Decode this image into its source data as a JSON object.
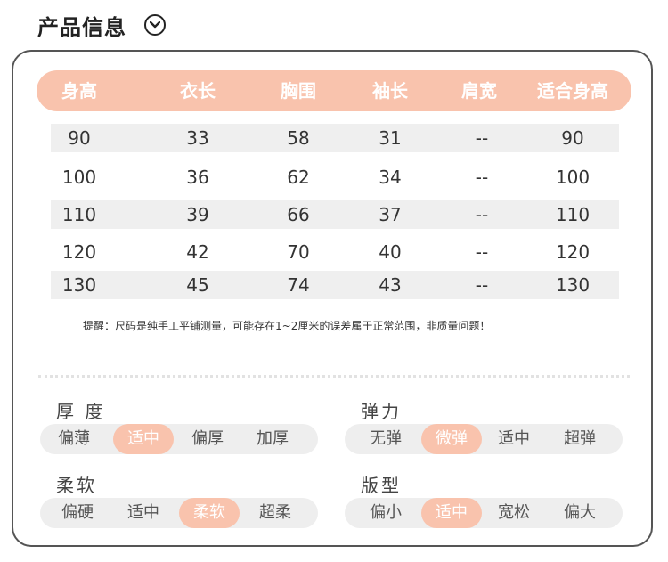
{
  "header": {
    "title": "产品信息",
    "icon": "chevron-down-circle-icon"
  },
  "table": {
    "headers": [
      "身高",
      "衣长",
      "胸围",
      "袖长",
      "肩宽",
      "适合身高"
    ],
    "rows": [
      [
        "90",
        "33",
        "58",
        "31",
        "--",
        "90"
      ],
      [
        "100",
        "36",
        "62",
        "34",
        "--",
        "100"
      ],
      [
        "110",
        "39",
        "66",
        "37",
        "--",
        "110"
      ],
      [
        "120",
        "42",
        "70",
        "40",
        "--",
        "120"
      ],
      [
        "130",
        "45",
        "74",
        "43",
        "--",
        "130"
      ]
    ]
  },
  "note": "提醒：尺码是纯手工平铺测量，可能存在1~2厘米的误差属于正常范围，非质量问题！",
  "attributes": [
    {
      "label": "厚 度",
      "options": [
        "偏薄",
        "适中",
        "偏厚",
        "加厚"
      ],
      "selected": "适中"
    },
    {
      "label": "弹力",
      "options": [
        "无弹",
        "微弹",
        "适中",
        "超弹"
      ],
      "selected": "微弹"
    },
    {
      "label": "柔软",
      "options": [
        "偏硬",
        "适中",
        "柔软",
        "超柔"
      ],
      "selected": "柔软"
    },
    {
      "label": "版型",
      "options": [
        "偏小",
        "适中",
        "宽松",
        "偏大"
      ],
      "selected": "适中"
    }
  ],
  "colors": {
    "accent": "#f9c3ad",
    "stripe": "#efefef",
    "border": "#555555"
  }
}
